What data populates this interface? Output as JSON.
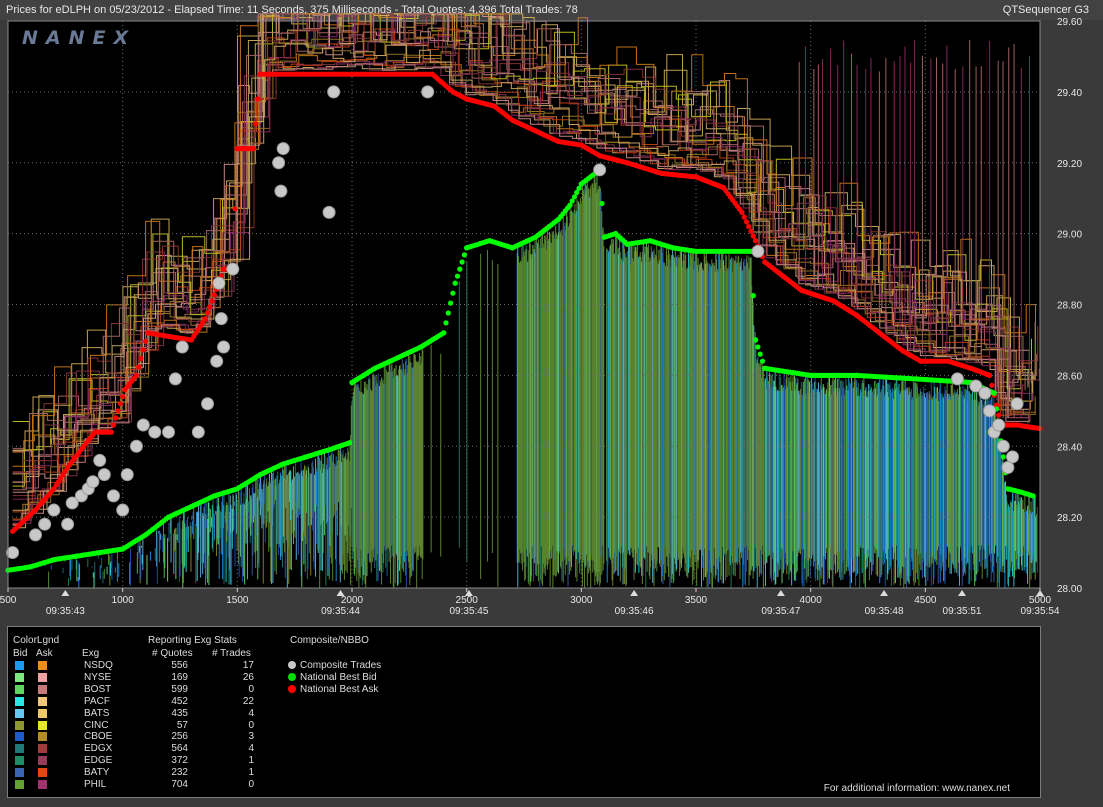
{
  "header": {
    "title": "Prices for  eDLPH  on  05/23/2012  -  Elapsed Time: 11 Seconds, 375 Milliseconds  -  Total Quotes: 4,396  Total Trades: 78",
    "brand": "QTSequencer G3"
  },
  "watermark": "NANEX",
  "chart_data": {
    "type": "line",
    "y_ticks": [
      "29.60",
      "29.40",
      "29.20",
      "29.00",
      "28.80",
      "28.60",
      "28.40",
      "28.20",
      "28.00"
    ],
    "y_range": [
      28.0,
      29.6
    ],
    "x_range": [
      500,
      5000
    ],
    "x_ticks": [
      "500",
      "1000",
      "1500",
      "2000",
      "2500",
      "3000",
      "3500",
      "4000",
      "4500",
      "5000"
    ],
    "time_labels": [
      {
        "x": 750,
        "t": "09:35:43"
      },
      {
        "x": 1950,
        "t": "09:35:44"
      },
      {
        "x": 2510,
        "t": "09:35:45"
      },
      {
        "x": 3230,
        "t": "09:35:46"
      },
      {
        "x": 3870,
        "t": "09:35:47"
      },
      {
        "x": 4320,
        "t": "09:35:48"
      },
      {
        "x": 4660,
        "t": "09:35:51"
      },
      {
        "x": 5000,
        "t": "09:35:54"
      }
    ],
    "series": [
      {
        "name": "National Best Ask",
        "color": "#ff0000",
        "points": [
          [
            520,
            28.16
          ],
          [
            620,
            28.22
          ],
          [
            700,
            28.28
          ],
          [
            760,
            28.34
          ],
          [
            830,
            28.4
          ],
          [
            880,
            28.44
          ],
          [
            950,
            28.44
          ],
          [
            1010,
            28.56
          ],
          [
            1060,
            28.6
          ],
          [
            1110,
            28.72
          ],
          [
            1200,
            28.71
          ],
          [
            1300,
            28.7
          ],
          [
            1360,
            28.76
          ],
          [
            1420,
            28.86
          ],
          [
            1440,
            28.9
          ],
          [
            1480,
            28.9
          ],
          [
            1500,
            29.24
          ],
          [
            1570,
            29.24
          ],
          [
            1600,
            29.45
          ],
          [
            2000,
            29.45
          ],
          [
            2350,
            29.45
          ],
          [
            2440,
            29.4
          ],
          [
            2500,
            29.38
          ],
          [
            2620,
            29.36
          ],
          [
            2700,
            29.32
          ],
          [
            2800,
            29.29
          ],
          [
            2900,
            29.26
          ],
          [
            3000,
            29.25
          ],
          [
            3080,
            29.22
          ],
          [
            3200,
            29.2
          ],
          [
            3350,
            29.17
          ],
          [
            3500,
            29.16
          ],
          [
            3620,
            29.13
          ],
          [
            3700,
            29.06
          ],
          [
            3760,
            28.98
          ],
          [
            3800,
            28.92
          ],
          [
            3880,
            28.88
          ],
          [
            3960,
            28.84
          ],
          [
            4100,
            28.81
          ],
          [
            4200,
            28.77
          ],
          [
            4300,
            28.72
          ],
          [
            4400,
            28.67
          ],
          [
            4480,
            28.64
          ],
          [
            4600,
            28.64
          ],
          [
            4700,
            28.62
          ],
          [
            4780,
            28.6
          ],
          [
            4830,
            28.46
          ],
          [
            4900,
            28.46
          ],
          [
            5000,
            28.45
          ]
        ]
      },
      {
        "name": "National Best Bid",
        "color": "#00ff00",
        "points": [
          [
            500,
            28.05
          ],
          [
            600,
            28.06
          ],
          [
            700,
            28.08
          ],
          [
            800,
            28.09
          ],
          [
            900,
            28.1
          ],
          [
            1000,
            28.11
          ],
          [
            1100,
            28.15
          ],
          [
            1200,
            28.2
          ],
          [
            1300,
            28.23
          ],
          [
            1400,
            28.26
          ],
          [
            1500,
            28.28
          ],
          [
            1600,
            28.32
          ],
          [
            1700,
            28.35
          ],
          [
            1800,
            28.37
          ],
          [
            1900,
            28.39
          ],
          [
            1990,
            28.41
          ],
          [
            2000,
            28.58
          ],
          [
            2100,
            28.62
          ],
          [
            2200,
            28.65
          ],
          [
            2300,
            28.68
          ],
          [
            2400,
            28.72
          ],
          [
            2450,
            28.86
          ],
          [
            2500,
            28.96
          ],
          [
            2600,
            28.98
          ],
          [
            2700,
            28.96
          ],
          [
            2800,
            28.99
          ],
          [
            2900,
            29.04
          ],
          [
            2950,
            29.08
          ],
          [
            3000,
            29.14
          ],
          [
            3080,
            29.18
          ],
          [
            3100,
            28.99
          ],
          [
            3150,
            29.0
          ],
          [
            3200,
            28.97
          ],
          [
            3300,
            28.98
          ],
          [
            3400,
            28.96
          ],
          [
            3500,
            28.95
          ],
          [
            3740,
            28.95
          ],
          [
            3760,
            28.7
          ],
          [
            3800,
            28.62
          ],
          [
            3900,
            28.61
          ],
          [
            4000,
            28.6
          ],
          [
            4200,
            28.6
          ],
          [
            4460,
            28.59
          ],
          [
            4700,
            28.58
          ],
          [
            4800,
            28.55
          ],
          [
            4860,
            28.28
          ],
          [
            4920,
            28.27
          ],
          [
            4970,
            28.26
          ]
        ]
      }
    ],
    "trades": [
      [
        520,
        28.1
      ],
      [
        620,
        28.15
      ],
      [
        660,
        28.18
      ],
      [
        700,
        28.22
      ],
      [
        760,
        28.18
      ],
      [
        780,
        28.24
      ],
      [
        820,
        28.26
      ],
      [
        850,
        28.28
      ],
      [
        870,
        28.3
      ],
      [
        900,
        28.36
      ],
      [
        920,
        28.32
      ],
      [
        960,
        28.26
      ],
      [
        1000,
        28.22
      ],
      [
        1020,
        28.32
      ],
      [
        1060,
        28.4
      ],
      [
        1090,
        28.46
      ],
      [
        1140,
        28.44
      ],
      [
        1200,
        28.44
      ],
      [
        1230,
        28.59
      ],
      [
        1260,
        28.68
      ],
      [
        1330,
        28.44
      ],
      [
        1370,
        28.52
      ],
      [
        1410,
        28.64
      ],
      [
        1420,
        28.86
      ],
      [
        1430,
        28.76
      ],
      [
        1440,
        28.68
      ],
      [
        1480,
        28.9
      ],
      [
        1680,
        29.2
      ],
      [
        1700,
        29.24
      ],
      [
        1690,
        29.12
      ],
      [
        1920,
        29.4
      ],
      [
        1900,
        29.06
      ],
      [
        2330,
        29.4
      ],
      [
        3080,
        29.18
      ],
      [
        3770,
        28.95
      ],
      [
        4640,
        28.59
      ],
      [
        4720,
        28.57
      ],
      [
        4760,
        28.55
      ],
      [
        4780,
        28.5
      ],
      [
        4800,
        28.44
      ],
      [
        4820,
        28.46
      ],
      [
        4840,
        28.4
      ],
      [
        4860,
        28.34
      ],
      [
        4880,
        28.37
      ],
      [
        4900,
        28.52
      ]
    ]
  },
  "legend": {
    "title": "ColorLgnd",
    "bid_label": "Bid",
    "ask_label": "Ask",
    "exg_label": "Exg",
    "stats_title": "Reporting Exg Stats",
    "quotes_label": "# Quotes",
    "trades_label": "# Trades",
    "composite_title": "Composite/NBBO",
    "rows": [
      {
        "exg": "NSDQ",
        "quotes": "556",
        "trades": "17",
        "bid": "#1e9bf0",
        "ask": "#f08c1e"
      },
      {
        "exg": "NYSE",
        "quotes": "169",
        "trades": "26",
        "bid": "#7ee87e",
        "ask": "#f0a0a0"
      },
      {
        "exg": "BOST",
        "quotes": "599",
        "trades": "0",
        "bid": "#5fd45f",
        "ask": "#c87878"
      },
      {
        "exg": "PACF",
        "quotes": "452",
        "trades": "22",
        "bid": "#28e6e6",
        "ask": "#f0c878"
      },
      {
        "exg": "BATS",
        "quotes": "435",
        "trades": "4",
        "bid": "#64c8f0",
        "ask": "#f0c864"
      },
      {
        "exg": "CINC",
        "quotes": "57",
        "trades": "0",
        "bid": "#8c9632",
        "ask": "#e6e628"
      },
      {
        "exg": "CBOE",
        "quotes": "256",
        "trades": "3",
        "bid": "#1e5ac8",
        "ask": "#b48c28"
      },
      {
        "exg": "EDGX",
        "quotes": "564",
        "trades": "4",
        "bid": "#1e7878",
        "ask": "#a03c3c"
      },
      {
        "exg": "EDGE",
        "quotes": "372",
        "trades": "1",
        "bid": "#1e8c64",
        "ask": "#963c5a"
      },
      {
        "exg": "BATY",
        "quotes": "232",
        "trades": "1",
        "bid": "#3c64b4",
        "ask": "#e64614"
      },
      {
        "exg": "PHIL",
        "quotes": "704",
        "trades": "0",
        "bid": "#64a032",
        "ask": "#a0326e"
      }
    ],
    "composite": [
      {
        "label": "Composite Trades",
        "color": "#c8c8c8"
      },
      {
        "label": "National Best Bid",
        "color": "#00e000"
      },
      {
        "label": "National Best Ask",
        "color": "#ff0000"
      }
    ],
    "footer": "For additional information: www.nanex.net"
  }
}
